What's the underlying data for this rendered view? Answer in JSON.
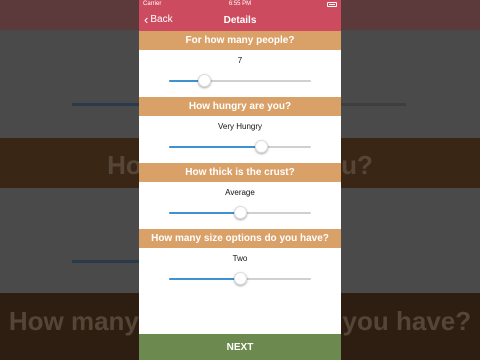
{
  "status": {
    "carrier": "Carrier",
    "time": "6:55 PM"
  },
  "nav": {
    "back_label": "Back",
    "title": "Details"
  },
  "background": {
    "text_1": "How hungry are you?",
    "text_2": "How many size options do you have?"
  },
  "questions": [
    {
      "label": "For how many people?",
      "value": "7",
      "fraction": 0.25
    },
    {
      "label": "How hungry are you?",
      "value": "Very Hungry",
      "fraction": 0.65
    },
    {
      "label": "How thick is the crust?",
      "value": "Average",
      "fraction": 0.5
    },
    {
      "label": "How many size options do you have?",
      "value": "Two",
      "fraction": 0.5
    }
  ],
  "next_label": "NEXT",
  "colors": {
    "brand": "#cc4b5f",
    "section": "#d9a068",
    "next": "#6c8a4f",
    "slider": "#3f92d0"
  }
}
